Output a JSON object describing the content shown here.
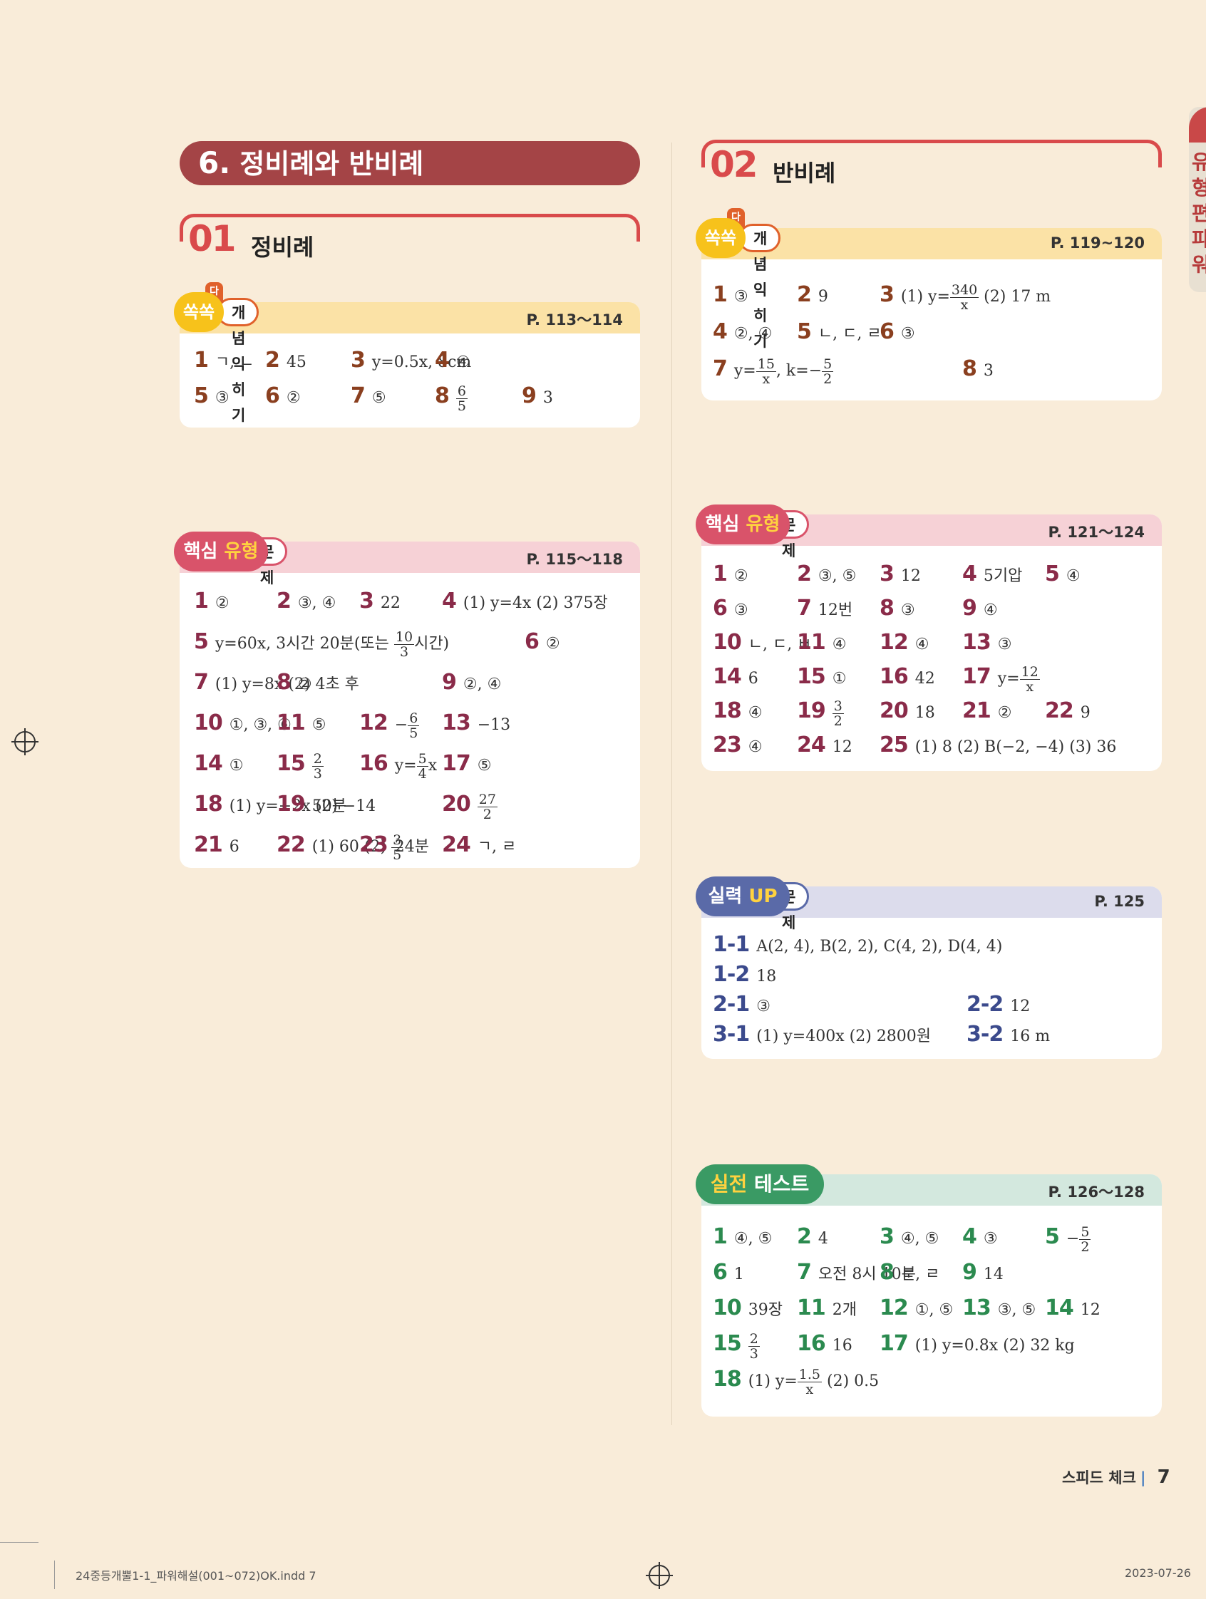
{
  "chapter": {
    "num": "6.",
    "title": "정비례와 반비례"
  },
  "side_tab": "유형편 파워",
  "footer": {
    "label": "스피드 체크",
    "sep": "|",
    "page": "7"
  },
  "slug": {
    "file": "24중등개뿔1-1_파워해설(001~072)OK.indd   7",
    "date": "2023-07-26"
  },
  "left": {
    "section": {
      "no": "01",
      "title": "정비례"
    },
    "concept": {
      "tag": "다시",
      "badge": "쏙쏙",
      "label": "개념 익히기",
      "pages": "P. 113～114",
      "rows": [
        [
          {
            "n": "1",
            "a": "ㄱ, ㄴ"
          },
          {
            "n": "2",
            "a": "45"
          },
          {
            "n": "3",
            "a": "y=0.5x, 8cm"
          },
          {
            "n": "4",
            "a": "④"
          }
        ],
        [
          {
            "n": "5",
            "a": "③"
          },
          {
            "n": "6",
            "a": "②"
          },
          {
            "n": "7",
            "a": "⑤"
          },
          {
            "n": "8",
            "a": "",
            "ft": "6",
            "fb": "5"
          },
          {
            "n": "9",
            "a": "3"
          }
        ]
      ]
    },
    "core": {
      "badge1": "핵심",
      "badge2": "유형",
      "label": "문제",
      "pages": "P. 115～118",
      "rows": [
        [
          {
            "n": "1",
            "a": "②"
          },
          {
            "n": "2",
            "a": "③, ④"
          },
          {
            "n": "3",
            "a": "22"
          },
          {
            "n": "4",
            "a": "(1) y=4x   (2) 375장"
          }
        ],
        [
          {
            "n": "5",
            "a": "y=60x, 3시간 20분(또는 ",
            "ft": "10",
            "fb": "3",
            "post": "시간)"
          },
          {
            "n": "6",
            "a": "②"
          }
        ],
        [
          {
            "n": "7",
            "a": "(1) y=8x   (2) 4초 후"
          },
          {
            "n": "8",
            "a": "②"
          },
          {
            "n": "9",
            "a": "②, ④"
          }
        ],
        [
          {
            "n": "10",
            "a": "①, ③, ⑥"
          },
          {
            "n": "11",
            "a": "⑤"
          },
          {
            "n": "12",
            "a": "−",
            "ft": "6",
            "fb": "5"
          },
          {
            "n": "13",
            "a": "−13"
          }
        ],
        [
          {
            "n": "14",
            "a": "①"
          },
          {
            "n": "15",
            "a": "",
            "ft": "2",
            "fb": "3"
          },
          {
            "n": "16",
            "a": "y=",
            "ft": "5",
            "fb": "4",
            "post": "x"
          },
          {
            "n": "17",
            "a": "⑤"
          }
        ],
        [
          {
            "n": "18",
            "a": "(1) y=−2x   (2) −14"
          },
          {
            "n": "19",
            "a": "50분"
          },
          {
            "n": "20",
            "a": "",
            "ft": "27",
            "fb": "2"
          }
        ],
        [
          {
            "n": "21",
            "a": "6"
          },
          {
            "n": "22",
            "a": "(1) 60   (2) ",
            "ft": "3",
            "fb": "5"
          },
          {
            "n": "23",
            "a": "24분"
          },
          {
            "n": "24",
            "a": "ㄱ, ㄹ"
          }
        ]
      ]
    }
  },
  "right": {
    "section": {
      "no": "02",
      "title": "반비례"
    },
    "concept": {
      "tag": "다시",
      "badge": "쏙쏙",
      "label": "개념 익히기",
      "pages": "P. 119~120",
      "rows": [
        [
          {
            "n": "1",
            "a": "③"
          },
          {
            "n": "2",
            "a": "9"
          },
          {
            "n": "3",
            "a": "(1) y=",
            "ft": "340",
            "fb": "x",
            "post": "   (2) 17 m"
          }
        ],
        [
          {
            "n": "4",
            "a": "②, ④"
          },
          {
            "n": "5",
            "a": "ㄴ, ㄷ, ㄹ"
          },
          {
            "n": "6",
            "a": "③"
          }
        ],
        [
          {
            "n": "7",
            "a": "y=",
            "ft": "15",
            "fb": "x",
            "post": ", k=−",
            "ft2": "5",
            "fb2": "2"
          },
          {
            "n": "8",
            "a": "3"
          }
        ]
      ]
    },
    "core": {
      "badge1": "핵심",
      "badge2": "유형",
      "label": "문제",
      "pages": "P. 121～124",
      "rows": [
        [
          {
            "n": "1",
            "a": "②"
          },
          {
            "n": "2",
            "a": "③, ⑤"
          },
          {
            "n": "3",
            "a": "12"
          },
          {
            "n": "4",
            "a": "5기압"
          },
          {
            "n": "5",
            "a": "④"
          }
        ],
        [
          {
            "n": "6",
            "a": "③"
          },
          {
            "n": "7",
            "a": "12번"
          },
          {
            "n": "8",
            "a": "③"
          },
          {
            "n": "9",
            "a": "④"
          }
        ],
        [
          {
            "n": "10",
            "a": "ㄴ, ㄷ, ㅂ"
          },
          {
            "n": "11",
            "a": "④"
          },
          {
            "n": "12",
            "a": "④"
          },
          {
            "n": "13",
            "a": "③"
          }
        ],
        [
          {
            "n": "14",
            "a": "6"
          },
          {
            "n": "15",
            "a": "①"
          },
          {
            "n": "16",
            "a": "42"
          },
          {
            "n": "17",
            "a": "y=",
            "ft": "12",
            "fb": "x"
          }
        ],
        [
          {
            "n": "18",
            "a": "④"
          },
          {
            "n": "19",
            "a": "",
            "ft": "3",
            "fb": "2"
          },
          {
            "n": "20",
            "a": "18"
          },
          {
            "n": "21",
            "a": "②"
          },
          {
            "n": "22",
            "a": "9"
          }
        ],
        [
          {
            "n": "23",
            "a": "④"
          },
          {
            "n": "24",
            "a": "12"
          },
          {
            "n": "25",
            "a": "(1) 8   (2) B(−2, −4)   (3) 36"
          }
        ]
      ]
    },
    "up": {
      "badge1": "실력",
      "badge2": "UP",
      "label": "문제",
      "pages": "P. 125",
      "rows": [
        [
          {
            "n": "1-1",
            "a": "A(2, 4), B(2, 2), C(4, 2), D(4, 4)"
          }
        ],
        [
          {
            "n": "1-2",
            "a": "18"
          }
        ],
        [
          {
            "n": "2-1",
            "a": "③"
          },
          {
            "n": "2-2",
            "a": "12"
          }
        ],
        [
          {
            "n": "3-1",
            "a": "(1) y=400x   (2) 2800원"
          },
          {
            "n": "3-2",
            "a": "16 m"
          }
        ]
      ]
    },
    "test": {
      "badge1": "실전",
      "badge2": "테스트",
      "pages": "P. 126～128",
      "rows": [
        [
          {
            "n": "1",
            "a": "④, ⑤"
          },
          {
            "n": "2",
            "a": "4"
          },
          {
            "n": "3",
            "a": "④, ⑤"
          },
          {
            "n": "4",
            "a": "③"
          },
          {
            "n": "5",
            "a": "−",
            "ft": "5",
            "fb": "2"
          }
        ],
        [
          {
            "n": "6",
            "a": "1"
          },
          {
            "n": "7",
            "a": "오전 8시 10분"
          },
          {
            "n": "8",
            "a": "ㄷ, ㄹ"
          },
          {
            "n": "9",
            "a": "14"
          }
        ],
        [
          {
            "n": "10",
            "a": "39장"
          },
          {
            "n": "11",
            "a": "2개"
          },
          {
            "n": "12",
            "a": "①, ⑤"
          },
          {
            "n": "13",
            "a": "③, ⑤"
          },
          {
            "n": "14",
            "a": "12"
          }
        ],
        [
          {
            "n": "15",
            "a": "",
            "ft": "2",
            "fb": "3"
          },
          {
            "n": "16",
            "a": "16"
          },
          {
            "n": "17",
            "a": "(1) y=0.8x   (2) 32 kg"
          }
        ],
        [
          {
            "n": "18",
            "a": "(1) y=",
            "ft": "1.5",
            "fb": "x",
            "post": "   (2) 0.5"
          }
        ]
      ]
    }
  }
}
